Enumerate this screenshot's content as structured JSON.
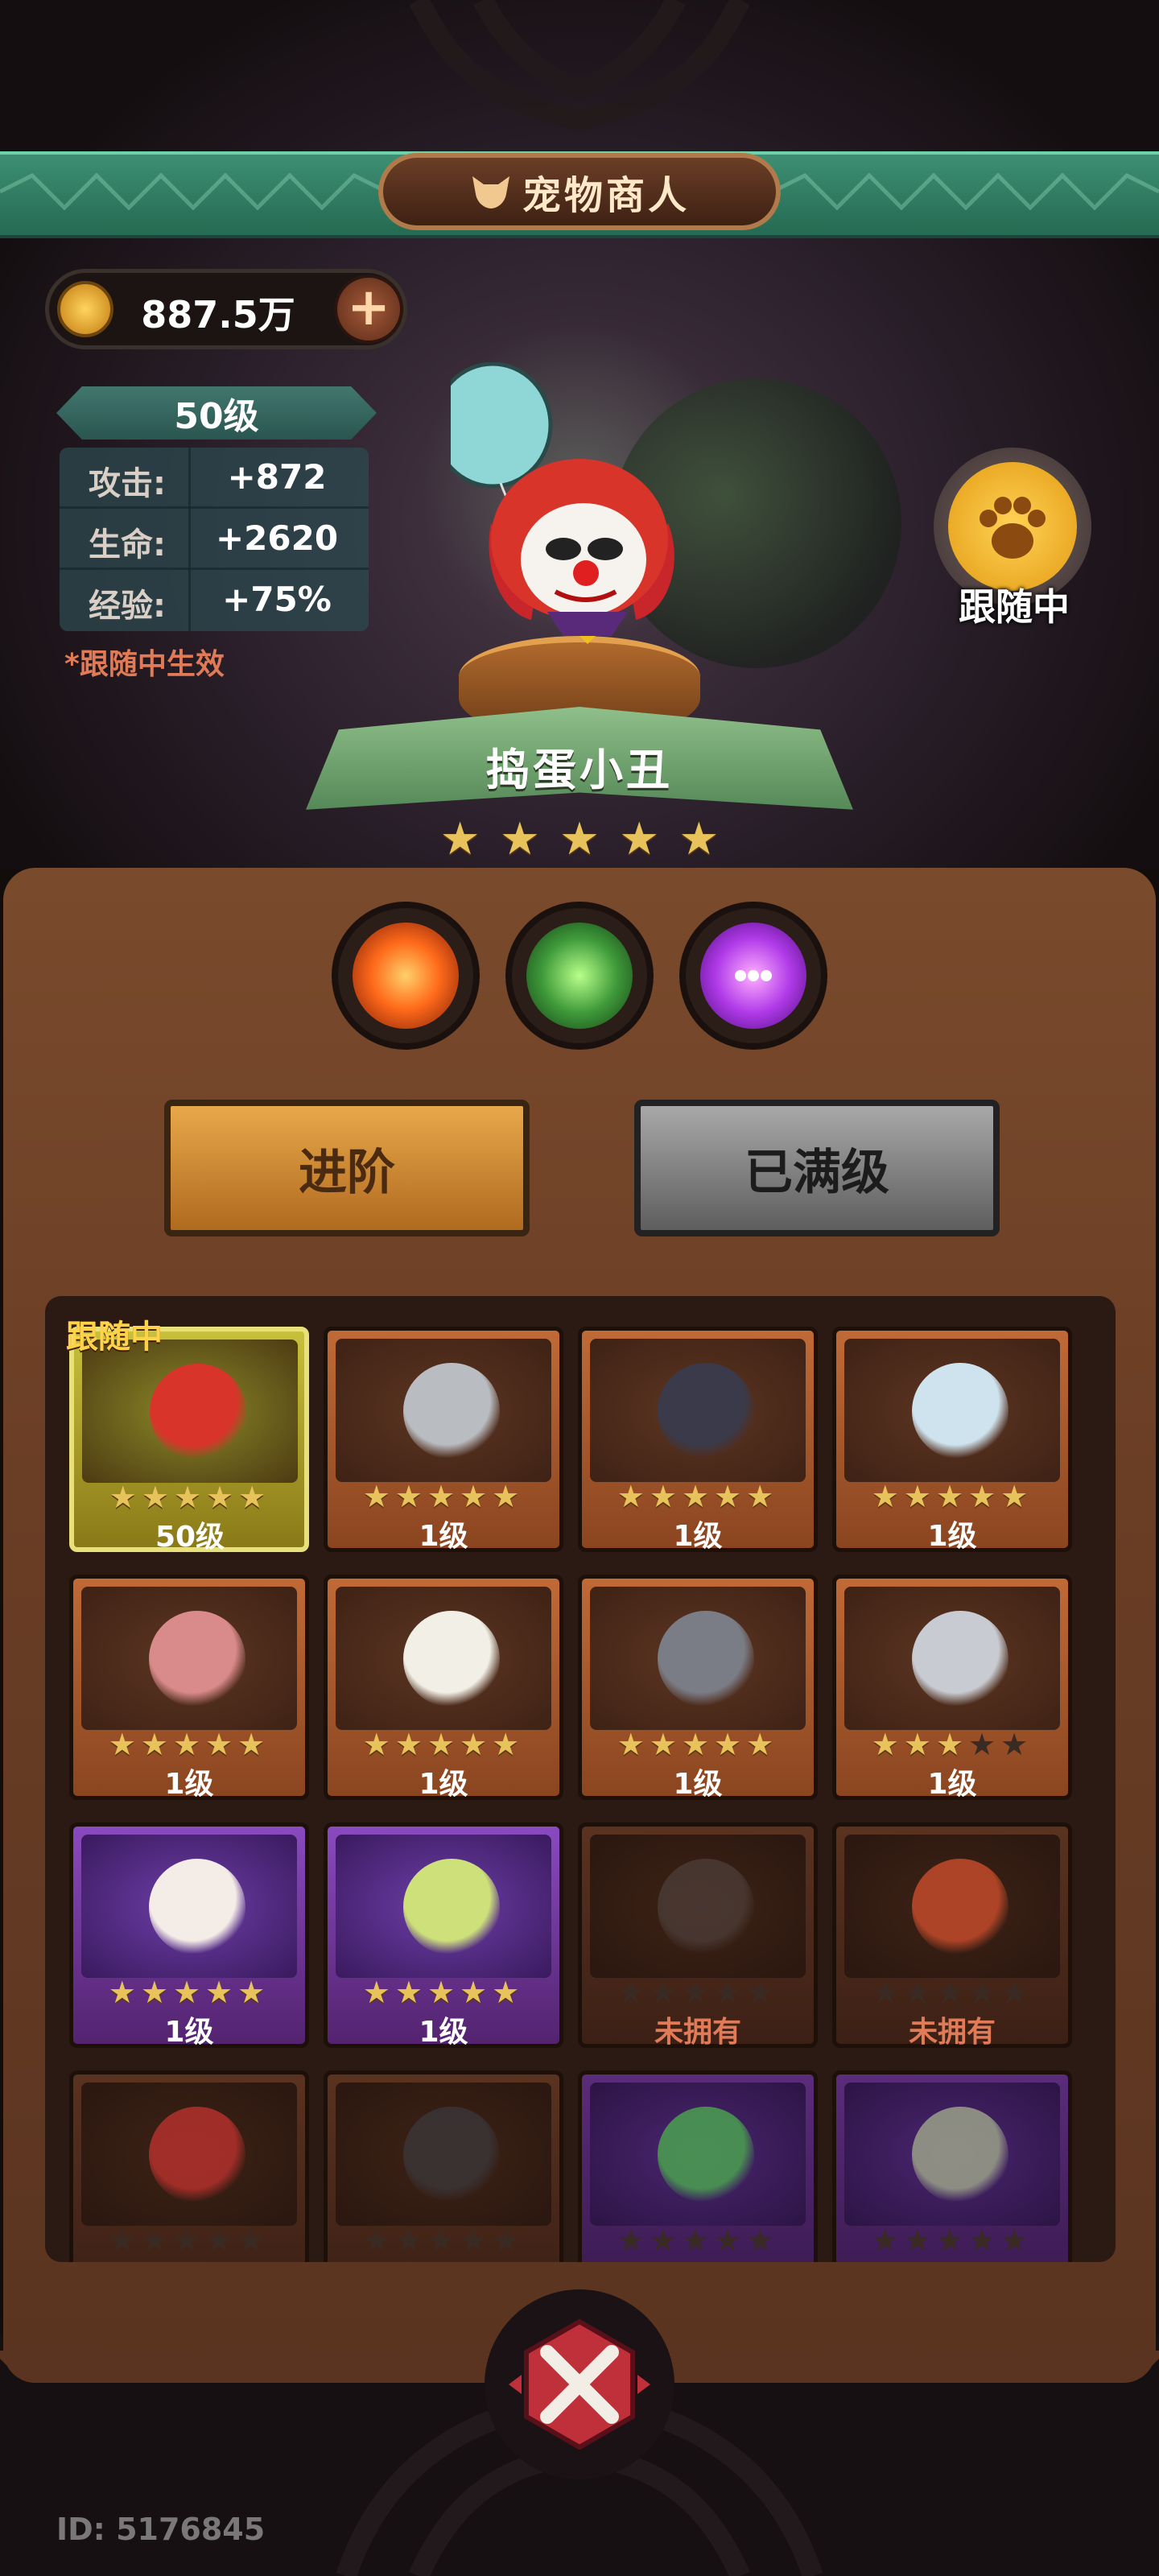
{
  "header": {
    "title": "宠物商人",
    "title_icon": "fox-head-icon"
  },
  "currency": {
    "icon": "coin-icon",
    "amount": "887.5万",
    "add_icon": "plus-icon"
  },
  "pet_info": {
    "level": "50级",
    "stats": [
      {
        "label": "攻击:",
        "value": "+872"
      },
      {
        "label": "生命:",
        "value": "+2620"
      },
      {
        "label": "经验:",
        "value": "+75%"
      }
    ],
    "note": "*跟随中生效",
    "name": "捣蛋小丑",
    "stars": 5,
    "follow_status": "跟随中",
    "follow_icon": "paw-icon"
  },
  "skills": [
    {
      "name": "fire-orb-icon",
      "color": "#ff7a2a"
    },
    {
      "name": "poison-claw-icon",
      "color": "#4fbf5a"
    },
    {
      "name": "chat-bubble-icon",
      "color": "#c06aff"
    }
  ],
  "buttons": {
    "advance": "进阶",
    "maxed": "已满级"
  },
  "pet_grid": {
    "following_tag": "跟随中",
    "cards": [
      {
        "theme": "selected",
        "pet": "clown-icon",
        "stars": 5,
        "level": "50级",
        "color": "#d8342a"
      },
      {
        "theme": "brown",
        "pet": "knight-helmet-icon",
        "stars": 5,
        "level": "1级",
        "color": "#b9bcc0"
      },
      {
        "theme": "brown",
        "pet": "crow-icon",
        "stars": 5,
        "level": "1级",
        "color": "#3a3a4a"
      },
      {
        "theme": "brown",
        "pet": "ice-spider-icon",
        "stars": 5,
        "level": "1级",
        "color": "#cfe3ee"
      },
      {
        "theme": "brown",
        "pet": "bear-icon",
        "stars": 5,
        "level": "1级",
        "color": "#d98a8a"
      },
      {
        "theme": "brown",
        "pet": "duck-icon",
        "stars": 5,
        "level": "1级",
        "color": "#f1efe6"
      },
      {
        "theme": "brown",
        "pet": "cat-icon",
        "stars": 5,
        "level": "1级",
        "color": "#7a7c86"
      },
      {
        "theme": "brown",
        "pet": "gauntlet-icon",
        "stars": 3,
        "level": "1级",
        "color": "#c8ccd2"
      },
      {
        "theme": "purple",
        "pet": "chicken-icon",
        "stars": 5,
        "level": "1级",
        "color": "#f4ece6"
      },
      {
        "theme": "purple",
        "pet": "deer-skull-icon",
        "stars": 5,
        "level": "1级",
        "color": "#cde07a"
      },
      {
        "theme": "dark",
        "pet": "mimic-chest-icon",
        "stars": 0,
        "level": "未拥有",
        "color": "#4a3a34"
      },
      {
        "theme": "dark",
        "pet": "fire-dragon-icon",
        "stars": 0,
        "level": "未拥有",
        "color": "#c24a2a"
      },
      {
        "theme": "dark",
        "pet": "daruma-icon",
        "stars": 0,
        "level": "",
        "color": "#b3302c"
      },
      {
        "theme": "dark",
        "pet": "penguin-icon",
        "stars": 0,
        "level": "",
        "color": "#3a3436"
      },
      {
        "theme": "darkpurple",
        "pet": "frog-icon",
        "stars": 0,
        "level": "",
        "color": "#4aa050"
      },
      {
        "theme": "darkpurple",
        "pet": "bird-icon",
        "stars": 0,
        "level": "",
        "color": "#9aa088"
      }
    ]
  },
  "footer": {
    "id_text": "ID: 5176845",
    "close_icon": "close-x-icon"
  }
}
